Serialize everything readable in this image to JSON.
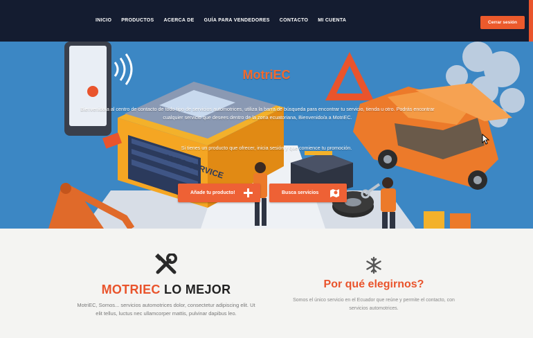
{
  "nav": {
    "links": [
      "INICIO",
      "PRODUCTOS",
      "ACERCA DE",
      "GUÍA PARA VENDEDORES",
      "CONTACTO",
      "MI CUENTA"
    ],
    "logout_label": "Cerrar sesión"
  },
  "hero": {
    "title": "MotriEC",
    "description": "Bienvenido/a al centro de contacto de todo tipo de servicios automotrices, utiliza la barra de búsqueda para encontrar tu servicio, tienda u otro. Podrás encontrar cualquier servicio que desees dentro de la zona ecuatoriana, Bienvenido/a a MotriEC.",
    "cta_text": "Si tienes un producto que ofrecer, inicia sesión y que comience tu promoción.",
    "add_button_label": "Añade tu producto!",
    "search_button_label": "Busca servicios",
    "sign_text": "AUTO SERVICE"
  },
  "features": {
    "left": {
      "icon": "tools-icon",
      "title_accent": "MOTRIEC",
      "title_rest": " LO MEJOR",
      "text": "MotriEC, Somos... servicios automotrices dolor, consectetur adipiscing elit. Ut elit tellus, luctus nec ullamcorper mattis, pulvinar dapibus leo."
    },
    "right": {
      "icon": "snowflake-icon",
      "title": "Por qué elegirnos?",
      "text": "Somos el único servicio en el Ecuador que reúne y permite el contacto, con servicios automotrices."
    }
  },
  "colors": {
    "navbar": "#141c30",
    "accent": "#ec5a2c",
    "hero_bg": "#3c87c4"
  }
}
